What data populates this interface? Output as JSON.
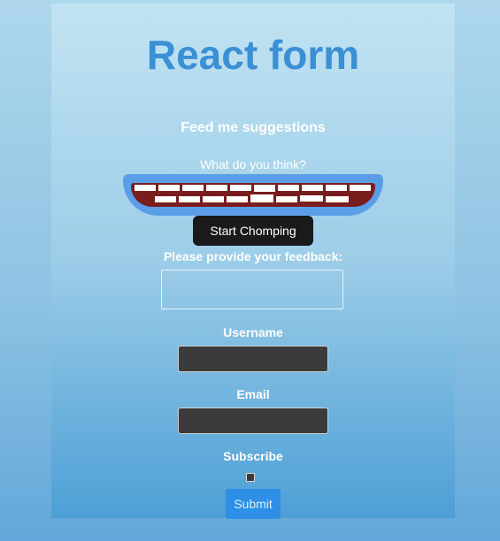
{
  "page": {
    "title": "React form",
    "subtitle": "Feed me suggestions",
    "question": "What do you think?"
  },
  "chomper": {
    "button_label": "Start Chomping",
    "colors": {
      "gum": "#5b9ee8",
      "mouth": "#7a1d1d",
      "tooth": "#ffffff"
    }
  },
  "form": {
    "feedback_label": "Please provide your feedback:",
    "feedback_value": "",
    "username_label": "Username",
    "username_value": "",
    "email_label": "Email",
    "email_value": "",
    "subscribe_label": "Subscribe",
    "subscribe_checked": false,
    "submit_label": "Submit"
  },
  "colors": {
    "title": "#3b8fd4",
    "submit_button": "#2d8fe6",
    "chomp_button": "#1a1a1a",
    "input_background": "#3b3b3b"
  }
}
